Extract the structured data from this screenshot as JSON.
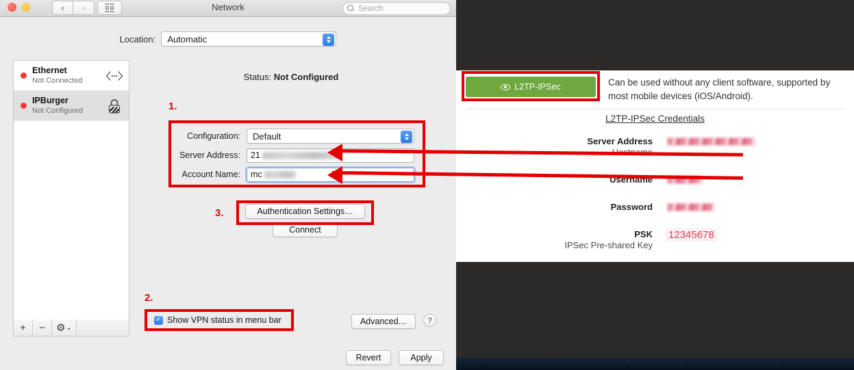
{
  "window": {
    "title": "Network",
    "search_placeholder": "Search",
    "nav_back": "‹",
    "nav_forward": "›",
    "grid_icon": "grid-view-icon"
  },
  "location": {
    "label": "Location:",
    "value": "Automatic"
  },
  "sidebar": {
    "services": [
      {
        "name": "Ethernet",
        "state": "Not Connected",
        "icon": "ethernet-icon",
        "selected": false
      },
      {
        "name": "IPBurger",
        "state": "Not Configured",
        "icon": "vpn-lock-icon",
        "selected": true
      }
    ],
    "footer": {
      "add": "+",
      "remove": "−",
      "gear": "⚙",
      "chevron": "⌄"
    }
  },
  "detail": {
    "status_label": "Status:",
    "status_value": "Not Configured",
    "fields": [
      {
        "label": "Configuration:",
        "value": "Default",
        "type": "popup"
      },
      {
        "label": "Server Address:",
        "value": "21",
        "type": "text",
        "redacted": true
      },
      {
        "label": "Account Name:",
        "value": "mc",
        "type": "text",
        "redacted": true,
        "focused": true
      }
    ],
    "auth_settings_button": "Authentication Settings…",
    "connect_button": "Connect",
    "show_vpn_status_label": "Show VPN status in menu bar",
    "show_vpn_status_checked": true,
    "checkmark": "✓",
    "advanced_button": "Advanced…",
    "help_button": "?",
    "revert_button": "Revert",
    "apply_button": "Apply"
  },
  "annotations": {
    "step1": "1.",
    "step2": "2.",
    "step3": "3.",
    "highlight_color": "#e40000"
  },
  "webpanel": {
    "protocol_button": "L2TP-IPSec",
    "protocol_button_color": "#6fa83e",
    "eye_icon": "eye-icon",
    "description": "Can be used without any client software, supported by most mobile devices (iOS/Android).",
    "credentials_title": "L2TP-IPSec Credentials",
    "credentials": [
      {
        "label": "Server Address",
        "sublabel": "Hostname",
        "value": "",
        "redacted": true,
        "value_width": 132
      },
      {
        "label": "Username",
        "sublabel": "",
        "value": "",
        "redacted": true,
        "value_width": 55
      },
      {
        "label": "Password",
        "sublabel": "",
        "value": "",
        "redacted": true,
        "value_width": 72
      },
      {
        "label": "PSK",
        "sublabel": "IPSec Pre-shared Key",
        "value": "12345678",
        "redacted": false,
        "value_width": 0
      }
    ]
  }
}
